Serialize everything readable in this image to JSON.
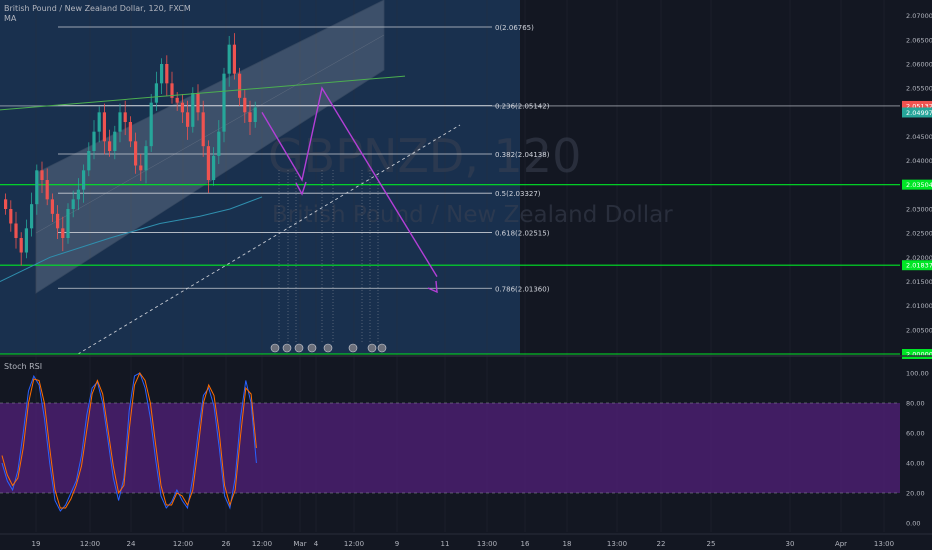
{
  "header": {
    "title": "British Pound / New Zealand Dollar, 120, FXCM",
    "indicator": "MA"
  },
  "watermark": {
    "symbol": "GBPNZD, 120",
    "name": "British Pound / New Zealand Dollar"
  },
  "colors": {
    "background": "#131722",
    "highlight_zone": "#1c3a5e",
    "channel": "#9598a1",
    "up_candle": "#26a69a",
    "down_candle": "#ef5350",
    "moving_average": "#2f8fae",
    "trend_line": "#4caf50",
    "projection": "#b33fd6",
    "support_line": "#00e626",
    "rsi_band": "#4a1f6e",
    "rsi_k": "#2962ff",
    "rsi_d": "#ff6d00"
  },
  "chart_data": [
    {
      "type": "candlestick",
      "title": "British Pound / New Zealand Dollar, 120, FXCM",
      "y_axis": {
        "ticks": [
          "2.07000",
          "2.06500",
          "2.06000",
          "2.05500",
          "2.05000",
          "2.04500",
          "2.04000",
          "2.03500",
          "2.03000",
          "2.02500",
          "2.02000",
          "2.01500",
          "2.01000",
          "2.00500",
          "2.00000"
        ],
        "range": [
          2.0,
          2.072
        ]
      },
      "x_axis": {
        "ticks": [
          "19",
          "12:00",
          "24",
          "12:00",
          "26",
          "12:00",
          "Mar",
          "4",
          "12:00",
          "9",
          "11",
          "13:00",
          "16",
          "18",
          "13:00",
          "22",
          "25",
          "30",
          "Apr",
          "13:00"
        ]
      },
      "price_labels": [
        {
          "text": "2.05132",
          "value": 2.05132,
          "color": "#ef5350"
        },
        {
          "text": "2.04997",
          "value": 2.04997,
          "color": "#26a69a"
        },
        {
          "text": "2.03504",
          "value": 2.03504,
          "color": "#00e626"
        },
        {
          "text": "2.01837",
          "value": 2.01837,
          "color": "#00e626"
        },
        {
          "text": "2.00000",
          "value": 2.0,
          "color": "#00e626"
        }
      ],
      "fibonacci": [
        {
          "label": "0(2.06765)",
          "value": 2.06765
        },
        {
          "label": "0.236(2.05142)",
          "value": 2.05142
        },
        {
          "label": "0.382(2.04138)",
          "value": 2.04138
        },
        {
          "label": "0.5(2.03327)",
          "value": 2.03327
        },
        {
          "label": "0.618(2.02515)",
          "value": 2.02515
        },
        {
          "label": "0.786(2.01360)",
          "value": 2.0136
        }
      ],
      "horizontal_levels": [
        2.05132,
        2.03504,
        2.01837,
        2.0
      ],
      "series": [
        {
          "values": [
            2.03,
            2.027,
            2.024,
            2.021,
            2.026,
            2.031,
            2.038,
            2.036,
            2.032,
            2.029,
            2.026,
            2.024,
            2.03,
            2.032,
            2.034,
            2.038,
            2.042,
            2.046,
            2.05,
            2.044,
            2.042,
            2.046,
            2.05,
            2.048,
            2.044,
            2.039,
            2.038,
            2.043,
            2.052,
            2.056,
            2.06,
            2.056,
            2.053,
            2.052,
            2.05,
            2.047,
            2.054,
            2.05,
            2.043,
            2.036,
            2.041,
            2.046,
            2.058,
            2.064,
            2.058,
            2.053,
            2.05,
            2.048,
            2.051
          ]
        },
        {
          "values": [
            2.015,
            2.02,
            2.024,
            2.027,
            2.0285,
            2.03,
            2.0325
          ]
        }
      ],
      "projection_path": [
        2.05,
        2.036,
        2.055,
        2.016
      ]
    },
    {
      "type": "line",
      "title": "Stoch RSI",
      "y_axis": {
        "ticks": [
          "100.00",
          "80.00",
          "60.00",
          "40.00",
          "20.00",
          "0.00"
        ],
        "range": [
          -6,
          110
        ]
      },
      "band": [
        20,
        80
      ],
      "series": [
        {
          "values": [
            40,
            28,
            22,
            35,
            60,
            88,
            98,
            92,
            70,
            40,
            15,
            8,
            12,
            20,
            28,
            45,
            72,
            90,
            94,
            80,
            55,
            30,
            15,
            30,
            75,
            98,
            100,
            90,
            70,
            42,
            18,
            10,
            14,
            22,
            15,
            10,
            30,
            60,
            85,
            90,
            78,
            50,
            18,
            10,
            30,
            70,
            95,
            80,
            40
          ]
        },
        {
          "values": [
            45,
            32,
            25,
            30,
            50,
            80,
            96,
            95,
            80,
            50,
            22,
            10,
            10,
            16,
            25,
            38,
            62,
            86,
            95,
            86,
            62,
            38,
            20,
            25,
            62,
            92,
            100,
            95,
            80,
            52,
            25,
            12,
            12,
            20,
            18,
            12,
            22,
            50,
            80,
            92,
            85,
            60,
            25,
            12,
            22,
            58,
            90,
            86,
            50
          ]
        }
      ]
    }
  ]
}
